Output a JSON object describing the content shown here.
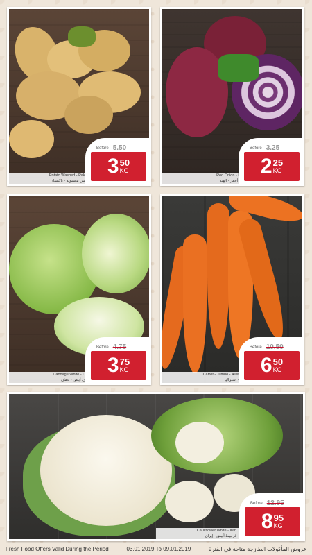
{
  "products": [
    {
      "name_en": "Potato Washed - Pakistan",
      "name_ar": "بطاطس مغسولة - باكستان",
      "before_label": "Before",
      "old_price": "5.50",
      "price_int": "3",
      "price_dec": "50",
      "unit": "KG"
    },
    {
      "name_en": "Red Onion - India",
      "name_ar": "بصل أحمر - الهند",
      "before_label": "Before",
      "old_price": "3.25",
      "price_int": "2",
      "price_dec": "25",
      "unit": "KG"
    },
    {
      "name_en": "Cabbage White - Oman",
      "name_ar": "ملفوف أبيض - عمان",
      "before_label": "Before",
      "old_price": "4.75",
      "price_int": "3",
      "price_dec": "75",
      "unit": "KG"
    },
    {
      "name_en": "Carrot - Jumbo - Australia",
      "name_ar": "جزر - أستراليا",
      "before_label": "Before",
      "old_price": "10.50",
      "price_int": "6",
      "price_dec": "50",
      "unit": "KG"
    },
    {
      "name_en": "Cauliflower White - Iran",
      "name_ar": "قرنبيط أبيض - إيران",
      "before_label": "Before",
      "old_price": "12.95",
      "price_int": "8",
      "price_dec": "95",
      "unit": "KG"
    }
  ],
  "footer": {
    "validity_en": "Fresh Food Offers Valid During the Period",
    "dates": "03.01.2019 To 09.01.2019",
    "validity_ar": "عروض المأكولات الطازجة متاحة في الفترة"
  }
}
